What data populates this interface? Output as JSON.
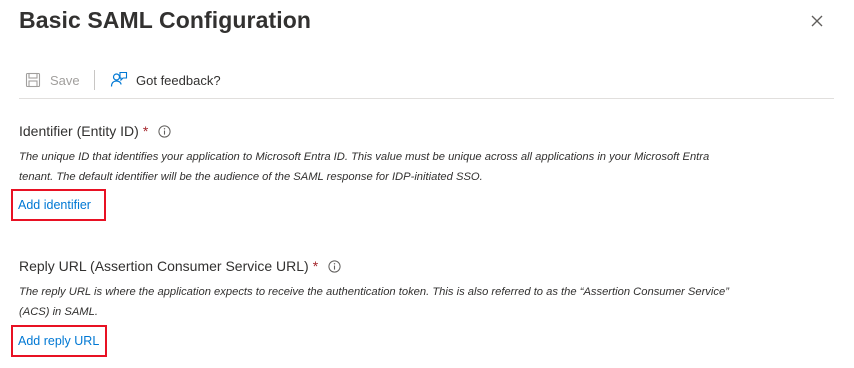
{
  "header": {
    "title": "Basic SAML Configuration"
  },
  "toolbar": {
    "save_label": "Save",
    "feedback_label": "Got feedback?"
  },
  "identifier": {
    "label": "Identifier (Entity ID)",
    "required_mark": "*",
    "description": "The unique ID that identifies your application to Microsoft Entra ID. This value must be unique across all applications in your Microsoft Entra tenant. The default identifier will be the audience of the SAML response for IDP-initiated SSO.",
    "add_link": "Add identifier"
  },
  "reply_url": {
    "label": "Reply URL (Assertion Consumer Service URL)",
    "required_mark": "*",
    "description": "The reply URL is where the application expects to receive the authentication token. This is also referred to as the “Assertion Consumer Service” (ACS) in SAML.",
    "add_link": "Add reply URL"
  },
  "icons": {
    "close": "close-icon",
    "save": "save-icon",
    "feedback": "feedback-icon",
    "info": "info-icon"
  },
  "colors": {
    "link": "#0078d4",
    "required": "#a4262c",
    "highlight_border": "#e81123"
  }
}
